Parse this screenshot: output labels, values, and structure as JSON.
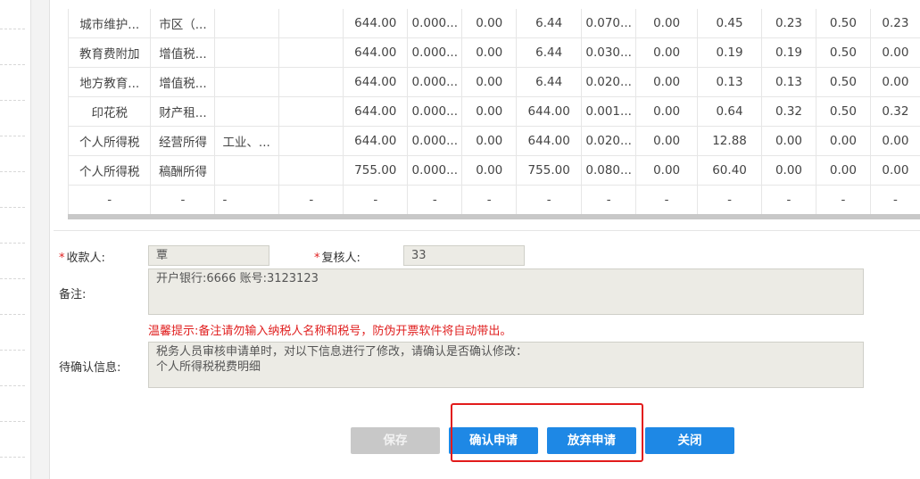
{
  "table": {
    "rows": [
      [
        "城市维护...",
        "市区（...",
        "",
        "",
        "644.00",
        "0.000...",
        "0.00",
        "6.44",
        "0.070...",
        "0.00",
        "0.45",
        "0.23",
        "0.50",
        "0.23"
      ],
      [
        "教育费附加",
        "增值税...",
        "",
        "",
        "644.00",
        "0.000...",
        "0.00",
        "6.44",
        "0.030...",
        "0.00",
        "0.19",
        "0.19",
        "0.50",
        "0.00"
      ],
      [
        "地方教育...",
        "增值税...",
        "",
        "",
        "644.00",
        "0.000...",
        "0.00",
        "6.44",
        "0.020...",
        "0.00",
        "0.13",
        "0.13",
        "0.50",
        "0.00"
      ],
      [
        "印花税",
        "财产租...",
        "",
        "",
        "644.00",
        "0.000...",
        "0.00",
        "644.00",
        "0.001...",
        "0.00",
        "0.64",
        "0.32",
        "0.50",
        "0.32"
      ],
      [
        "个人所得税",
        "经营所得",
        "工业、...",
        "",
        "644.00",
        "0.000...",
        "0.00",
        "644.00",
        "0.020...",
        "0.00",
        "12.88",
        "0.00",
        "0.00",
        "0.00"
      ],
      [
        "个人所得税",
        "稿酬所得",
        "",
        "",
        "755.00",
        "0.000...",
        "0.00",
        "755.00",
        "0.080...",
        "0.00",
        "60.40",
        "0.00",
        "0.00",
        "0.00"
      ],
      [
        "-",
        "-",
        "-",
        "-",
        "-",
        "-",
        "-",
        "-",
        "-",
        "-",
        "-",
        "-",
        "-",
        "-"
      ]
    ]
  },
  "form": {
    "payee_label": "收款人:",
    "payee_value": "覃",
    "reviewer_label": "复核人:",
    "reviewer_value": "33",
    "remark_label": "备注:",
    "remark_value": "开户银行:6666  账号:3123123",
    "warning": "温馨提示:备注请勿输入纳税人名称和税号，防伪开票软件将自动带出。",
    "pending_label": "待确认信息:",
    "pending_line1": "税务人员审核申请单时，对以下信息进行了修改，请确认是否确认修改：",
    "pending_line2": "个人所得税税费明细",
    "required_mark": "*"
  },
  "buttons": {
    "save": "保存",
    "confirm": "确认申请",
    "abandon": "放弃申请",
    "close": "关闭"
  },
  "colors": {
    "accent": "#1e88e5",
    "warning": "#e02020",
    "highlight": "#e21b1b",
    "disabled": "#c8c8c8"
  }
}
